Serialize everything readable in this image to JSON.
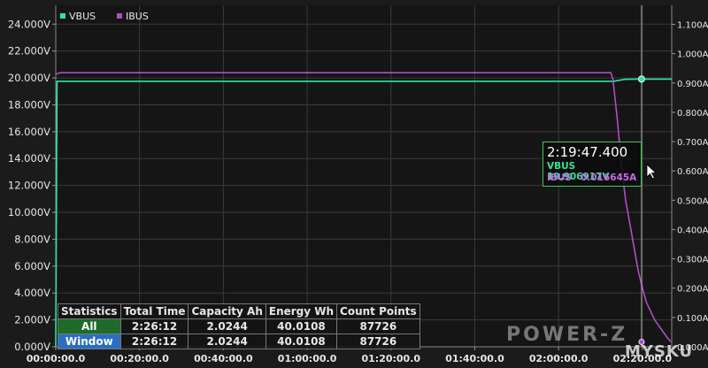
{
  "legend": [
    {
      "name": "VBUS",
      "color": "#2ee59d"
    },
    {
      "name": "IBUS",
      "color": "#b04cc8"
    }
  ],
  "chart_data": {
    "type": "line",
    "x_ticks": [
      "00:00:00.0",
      "00:20:00.0",
      "00:40:00.0",
      "01:00:00.0",
      "01:20:00.0",
      "01:40:00.0",
      "02:00:00.0",
      "02:20:00.0"
    ],
    "y_left_ticks": [
      "0.000V",
      "2.000V",
      "4.000V",
      "6.000V",
      "8.000V",
      "10.000V",
      "12.000V",
      "14.000V",
      "16.000V",
      "18.000V",
      "20.000V",
      "22.000V",
      "24.000V"
    ],
    "y_right_ticks": [
      "0.000A",
      "0.100A",
      "0.200A",
      "0.300A",
      "0.400A",
      "0.500A",
      "0.600A",
      "0.700A",
      "0.800A",
      "0.900A",
      "1.000A",
      "1.100A"
    ],
    "ylim_left": [
      0,
      25.4
    ],
    "ylim_right": [
      0,
      1.165
    ],
    "xlim_min": [
      0,
      147
    ],
    "grid": true,
    "series": [
      {
        "name": "VBUS",
        "axis": "left",
        "color": "#2ee59d",
        "x_min": [
          0,
          0.3,
          133,
          136,
          140,
          147
        ],
        "y": [
          0,
          19.75,
          19.75,
          19.9,
          19.91,
          19.91
        ]
      },
      {
        "name": "IBUS",
        "axis": "right",
        "color": "#b04cc8",
        "x_min": [
          0,
          1,
          50,
          100,
          132.5,
          133,
          134,
          135,
          136,
          137,
          138,
          139,
          140,
          141,
          142,
          143,
          144,
          145,
          146,
          146.8
        ],
        "y": [
          0.93,
          0.935,
          0.935,
          0.935,
          0.935,
          0.91,
          0.78,
          0.62,
          0.5,
          0.42,
          0.34,
          0.26,
          0.2,
          0.15,
          0.12,
          0.09,
          0.07,
          0.05,
          0.03,
          0.017
        ]
      }
    ],
    "cursor": {
      "label": "2:19:47.400",
      "x_min": 139.8,
      "rows": [
        {
          "name": "VBUS",
          "value": "19.906917V"
        },
        {
          "name": "IBUS",
          "value": "0.016645A"
        }
      ]
    }
  },
  "stats": {
    "headers": [
      "Statistics",
      "Total Time",
      "Capacity Ah",
      "Energy Wh",
      "Count Points"
    ],
    "rows": [
      {
        "label": "All",
        "total_time": "2:26:12",
        "capacity": "2.0244",
        "energy": "40.0108",
        "count": "87726"
      },
      {
        "label": "Window",
        "total_time": "2:26:12",
        "capacity": "2.0244",
        "energy": "40.0108",
        "count": "87726"
      }
    ]
  },
  "watermark": "POWER-Z",
  "site_mark": "MYSKU"
}
